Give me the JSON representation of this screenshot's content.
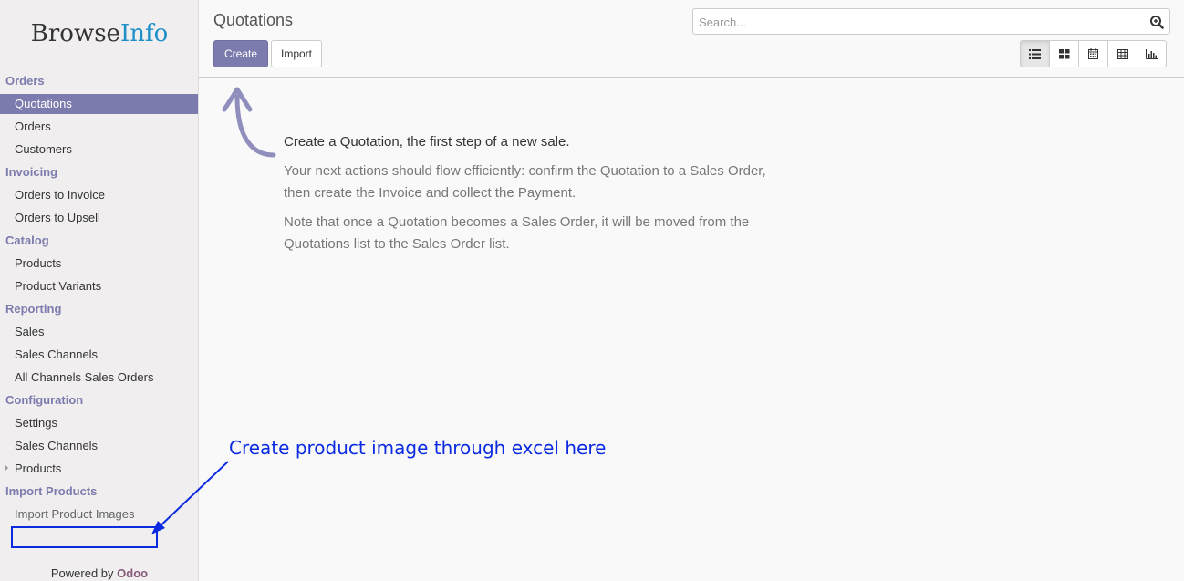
{
  "brand": {
    "part1": "Browse",
    "part2": "Info"
  },
  "sidebar": {
    "sections": [
      {
        "label": "Orders",
        "items": [
          {
            "label": "Quotations",
            "active": true
          },
          {
            "label": "Orders"
          },
          {
            "label": "Customers"
          }
        ]
      },
      {
        "label": "Invoicing",
        "items": [
          {
            "label": "Orders to Invoice"
          },
          {
            "label": "Orders to Upsell"
          }
        ]
      },
      {
        "label": "Catalog",
        "items": [
          {
            "label": "Products"
          },
          {
            "label": "Product Variants"
          }
        ]
      },
      {
        "label": "Reporting",
        "items": [
          {
            "label": "Sales"
          },
          {
            "label": "Sales Channels"
          },
          {
            "label": "All Channels Sales Orders"
          }
        ]
      },
      {
        "label": "Configuration",
        "items": [
          {
            "label": "Settings"
          },
          {
            "label": "Sales Channels"
          },
          {
            "label": "Products",
            "expandable": true
          }
        ]
      },
      {
        "label": "Import Products",
        "items": [
          {
            "label": "Import Product Images",
            "highlight": true
          }
        ]
      }
    ],
    "powered_by": "Powered by",
    "powered_brand": "Odoo"
  },
  "header": {
    "title": "Quotations",
    "create_label": "Create",
    "import_label": "Import",
    "search_placeholder": "Search...",
    "views": [
      "list-view-icon",
      "kanban-view-icon",
      "calendar-view-icon",
      "pivot-view-icon",
      "graph-view-icon"
    ]
  },
  "help": {
    "title": "Create a Quotation, the first step of a new sale.",
    "p1_line1": "Your next actions should flow efficiently: confirm the Quotation to a Sales Order,",
    "p1_line2": "then create the Invoice and collect the Payment.",
    "p2_line1": "Note that once a Quotation becomes a Sales Order, it will be moved from the",
    "p2_line2": "Quotations list to the Sales Order list."
  },
  "annotation": {
    "text": "Create product image through excel here"
  },
  "colors": {
    "accent": "#7c7bad",
    "annotation": "#0c2be0",
    "odoo": "#875a7b",
    "brand_info": "#1e90c9"
  }
}
